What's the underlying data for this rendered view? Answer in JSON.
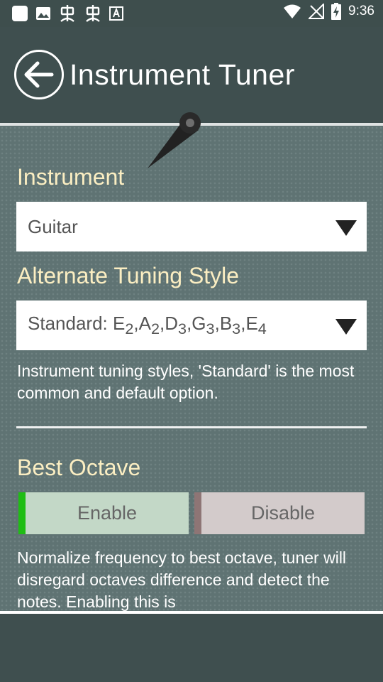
{
  "status_bar": {
    "time": "9:36",
    "left_icons": [
      "app-square-icon",
      "image-icon",
      "bug-icon",
      "bug-icon",
      "font-icon"
    ],
    "right_icons": [
      "wifi-icon",
      "no-signal-icon",
      "battery-charging-icon"
    ]
  },
  "header": {
    "title": "Instrument Tuner",
    "back_icon": "back-arrow-icon"
  },
  "instrument": {
    "label": "Instrument",
    "selected": "Guitar"
  },
  "tuning": {
    "label": "Alternate Tuning Style",
    "selected_prefix": "Standard: ",
    "notes": [
      {
        "n": "E",
        "o": "2"
      },
      {
        "n": "A",
        "o": "2"
      },
      {
        "n": "D",
        "o": "3"
      },
      {
        "n": "G",
        "o": "3"
      },
      {
        "n": "B",
        "o": "3"
      },
      {
        "n": "E",
        "o": "4"
      }
    ],
    "description": "Instrument tuning styles, 'Standard' is the most common and default option."
  },
  "best_octave": {
    "label": "Best Octave",
    "enable_label": "Enable",
    "disable_label": "Disable",
    "selected": "Enable",
    "description": "Normalize frequency to best octave, tuner will disregard octaves difference and detect the notes. Enabling this is"
  },
  "colors": {
    "label_accent": "#fbeec2",
    "enable_active": "#1fbd14"
  }
}
